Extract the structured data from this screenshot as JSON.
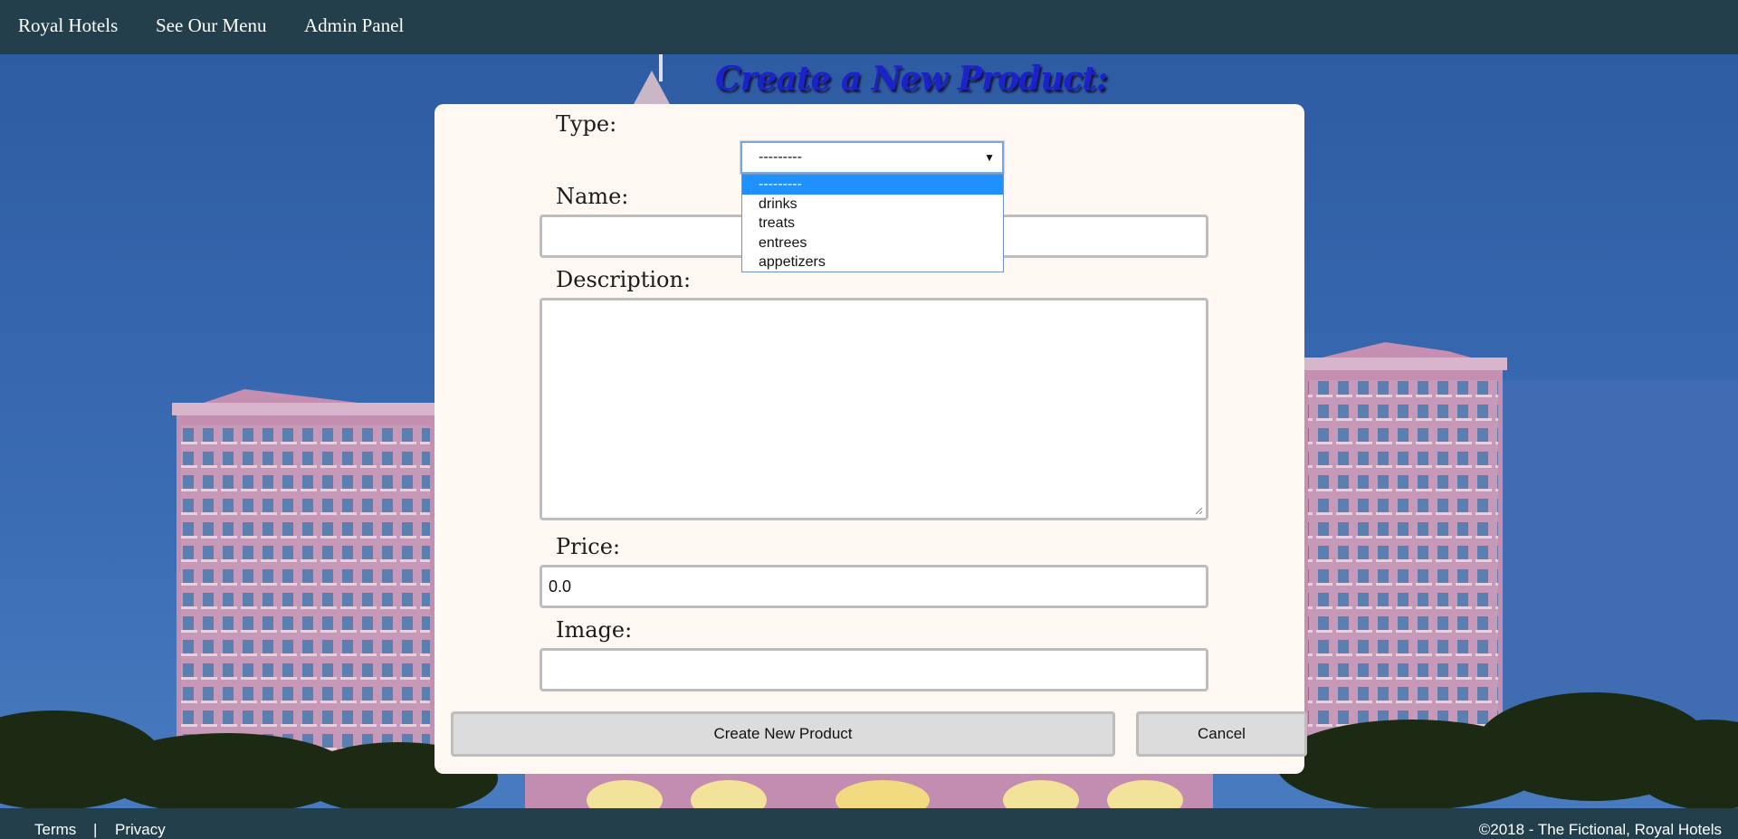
{
  "nav": {
    "brand": "Royal Hotels",
    "menu_link": "See Our Menu",
    "admin_link": "Admin Panel"
  },
  "page": {
    "title": "Create a New Product:"
  },
  "form": {
    "type_label": "Type:",
    "type_selected": "---------",
    "type_options": [
      "---------",
      "drinks",
      "treats",
      "entrees",
      "appetizers"
    ],
    "name_label": "Name:",
    "name_value": "",
    "description_label": "Description:",
    "description_value": "",
    "price_label": "Price:",
    "price_value": "0.0",
    "image_label": "Image:",
    "image_value": "",
    "submit_label": "Create New Product",
    "cancel_label": "Cancel"
  },
  "footer": {
    "terms": "Terms",
    "separator": "|",
    "privacy": "Privacy",
    "copyright": "©2018 - The Fictional, Royal Hotels"
  },
  "colors": {
    "nav_bg": "#233f4c",
    "panel_bg": "#fff8f2",
    "title": "#1a22c8",
    "option_highlight": "#1e90ff"
  },
  "icons": {
    "select_arrow": "dropdown-arrow-icon",
    "resize_grip": "resize-grip-icon"
  }
}
